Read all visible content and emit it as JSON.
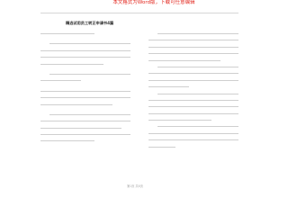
{
  "banner": {
    "text": "本文格式为Word版，下载可任意编辑"
  },
  "document": {
    "title": "精选试用员工转正申请书4篇"
  },
  "footer": {
    "page_label": "第1页 共6页"
  },
  "colors": {
    "banner": "#e2231a",
    "text_lines": "#cfcfcf",
    "background": "#ffffff"
  }
}
